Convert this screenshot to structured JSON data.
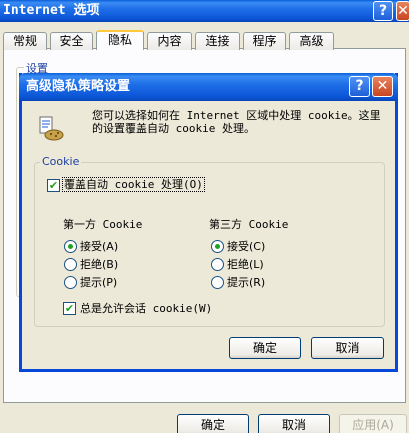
{
  "outer_window": {
    "title": "Internet 选项",
    "help_label": "?",
    "close_label": "✕",
    "tabs": [
      "常规",
      "安全",
      "隐私",
      "内容",
      "连接",
      "程序",
      "高级"
    ],
    "active_tab": "隐私",
    "settings_label": "设置",
    "ok_label": "确定",
    "cancel_label": "取消",
    "apply_label": "应用(A)"
  },
  "dialog": {
    "title": "高级隐私策略设置",
    "help_label": "?",
    "close_label": "✕",
    "description": "您可以选择如何在 Internet 区域中处理 cookie。这里的设置覆盖自动 cookie 处理。",
    "group_label": "Cookie",
    "override_label": "覆盖自动 cookie 处理(O)",
    "override_checked": true,
    "first_party": {
      "heading": "第一方 Cookie",
      "options": [
        "接受(A)",
        "拒绝(B)",
        "提示(P)"
      ],
      "selected": "接受(A)"
    },
    "third_party": {
      "heading": "第三方 Cookie",
      "options": [
        "接受(C)",
        "拒绝(L)",
        "提示(R)"
      ],
      "selected": "接受(C)"
    },
    "session_label": "总是允许会话 cookie(W)",
    "session_checked": true,
    "ok_label": "确定",
    "cancel_label": "取消"
  },
  "colors": {
    "titlebar": "#0b55d6",
    "dialog_bg": "#ece9d8",
    "check_green": "#21a121",
    "group_label_blue": "#1c3fa0"
  }
}
